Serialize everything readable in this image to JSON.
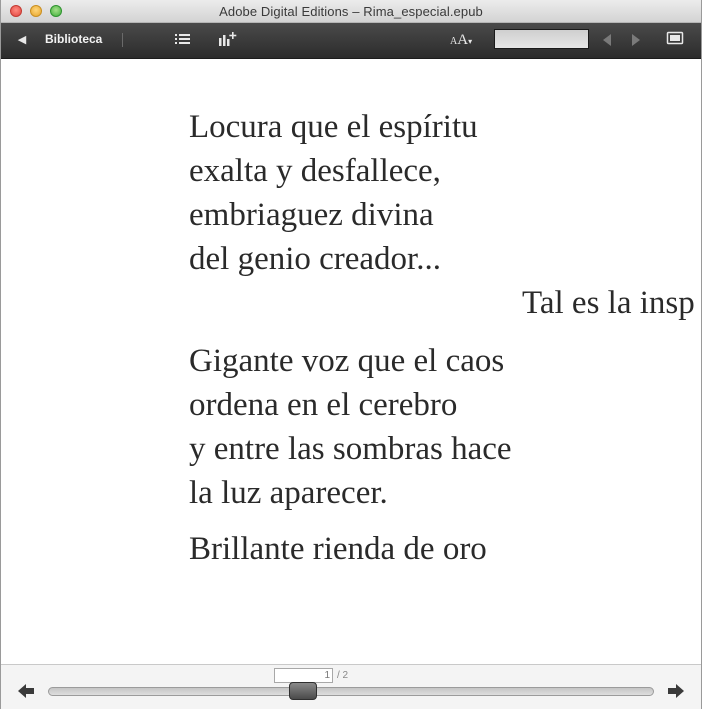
{
  "window": {
    "title": "Adobe Digital Editions – Rima_especial.epub"
  },
  "toolbar": {
    "library_label": "Biblioteca",
    "font_size_small": "A",
    "font_size_big": "A",
    "search_value": "",
    "icons": [
      "back-arrow-icon",
      "toc-list-icon",
      "add-bookmark-icon",
      "font-size-icon",
      "prev-result-icon",
      "next-result-icon",
      "fullscreen-icon"
    ]
  },
  "content": {
    "stanza1": [
      "Locura que el espíritu",
      "exalta y desfallece,",
      "embriaguez divina",
      "del genio creador..."
    ],
    "overflow_line": "Tal es la insp",
    "stanza2": [
      "Gigante voz que el caos",
      "ordena en el cerebro",
      "y entre las sombras hace",
      "la luz aparecer."
    ],
    "stanza3": [
      "Brillante rienda de oro"
    ]
  },
  "navigation": {
    "current_page": "1",
    "total_pages": "/ 2",
    "progress_fraction": 0.5
  },
  "colors": {
    "toolbar_bg": "#2c2c2c",
    "text": "#2a2a2a",
    "page_bg": "#ffffff"
  }
}
